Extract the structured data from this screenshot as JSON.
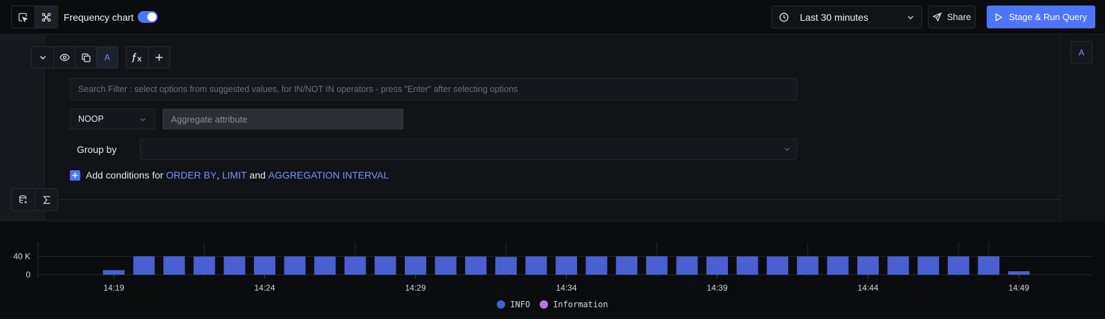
{
  "header": {
    "frequency_chart_label": "Frequency chart",
    "frequency_chart_enabled": true,
    "time_range": "Last 30 minutes",
    "share_label": "Share",
    "run_label": "Stage & Run Query"
  },
  "query": {
    "name": "A",
    "search_placeholder": "Search Filter : select options from suggested values, for IN/NOT IN operators - press \"Enter\" after selecting options",
    "aggregate_operator": "NOOP",
    "aggregate_attribute_placeholder": "Aggregate attribute",
    "group_by_label": "Group by",
    "add_conditions": {
      "prefix": "Add conditions for",
      "order_by": "ORDER BY",
      "comma": ",",
      "limit": "LIMIT",
      "and": "and",
      "aggregation_interval": "AGGREGATION INTERVAL"
    }
  },
  "colors": {
    "accent": "#4e74f8",
    "info": "#4a5fd1",
    "information": "#b57bd6"
  },
  "icons": {
    "view_list": "cursor-square-icon",
    "view_graph": "nodes-icon",
    "clock": "clock-icon",
    "share": "send-icon",
    "run": "play-icon"
  },
  "chart_data": {
    "type": "bar",
    "yticks": [
      "40 K",
      "0"
    ],
    "ytick_values": [
      40000,
      0
    ],
    "ylim": [
      0,
      45000
    ],
    "xticks": [
      "14:19",
      "14:24",
      "14:29",
      "14:34",
      "14:39",
      "14:44",
      "14:49"
    ],
    "categories": [
      "14:19",
      "14:20",
      "14:21",
      "14:22",
      "14:23",
      "14:24",
      "14:25",
      "14:26",
      "14:27",
      "14:28",
      "14:29",
      "14:30",
      "14:31",
      "14:32",
      "14:33",
      "14:34",
      "14:35",
      "14:36",
      "14:37",
      "14:38",
      "14:39",
      "14:40",
      "14:41",
      "14:42",
      "14:43",
      "14:44",
      "14:45",
      "14:46",
      "14:47",
      "14:48",
      "14:49"
    ],
    "series": [
      {
        "name": "INFO",
        "values": [
          10000,
          40000,
          40000,
          39500,
          39800,
          39800,
          39800,
          39600,
          39400,
          39800,
          39800,
          39600,
          39600,
          38600,
          39800,
          39800,
          39800,
          40000,
          40000,
          39800,
          39400,
          39800,
          39600,
          39800,
          39800,
          39800,
          39800,
          39600,
          39800,
          40000,
          7500
        ]
      },
      {
        "name": "Information",
        "values": [
          0,
          0,
          0,
          0,
          0,
          0,
          0,
          0,
          0,
          0,
          0,
          0,
          0,
          0,
          0,
          0,
          0,
          0,
          0,
          0,
          0,
          0,
          0,
          0,
          0,
          0,
          0,
          0,
          0,
          0,
          0
        ]
      }
    ],
    "grid": true,
    "legend_position": "bottom-center"
  }
}
